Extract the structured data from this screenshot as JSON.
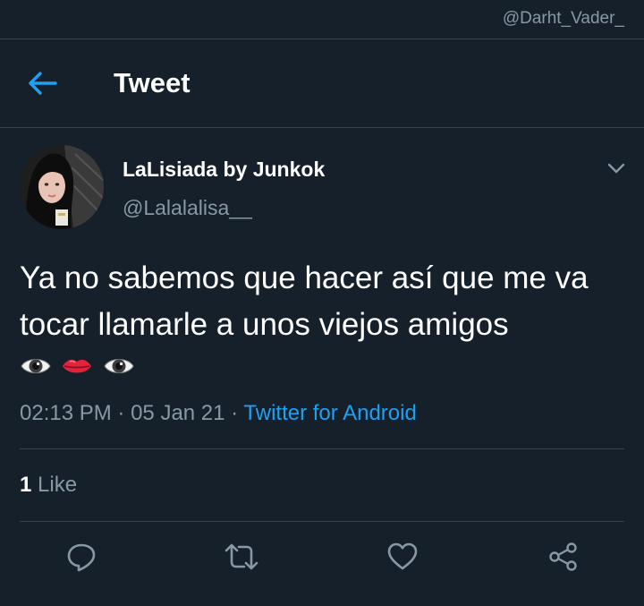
{
  "watermark": "@Darht_Vader_",
  "header": {
    "title": "Tweet",
    "back_icon": "arrow-left-icon"
  },
  "tweet": {
    "display_name": "LaLisiada by Junkok",
    "handle": "@Lalalalisa__",
    "text": "Ya no sabemos que hacer así que me va tocar llamarle a unos viejos amigos",
    "emojis": [
      "eye",
      "lips",
      "eye"
    ],
    "time": "02:13 PM",
    "date": "05 Jan 21",
    "source": "Twitter for Android",
    "likes_count": "1",
    "likes_label": "Like"
  },
  "actions": [
    "reply-icon",
    "retweet-icon",
    "like-icon",
    "share-icon"
  ],
  "colors": {
    "background": "#15202b",
    "accent": "#1da1f2",
    "secondary_text": "#8899a6",
    "divider": "#38444d"
  }
}
